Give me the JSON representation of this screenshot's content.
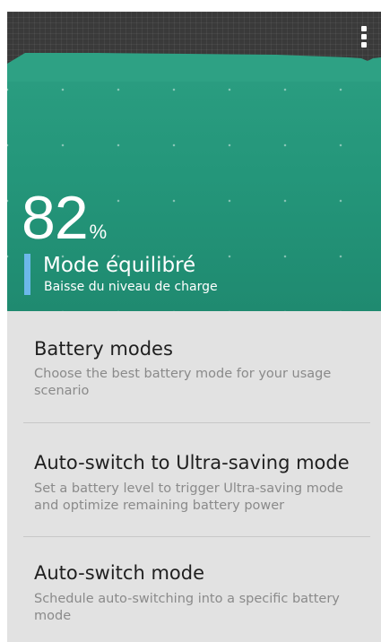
{
  "battery": {
    "percent": "82",
    "percent_sign": "%",
    "mode_title": "Mode équilibré",
    "mode_subtitle": "Baisse du niveau de charge"
  },
  "settings": {
    "items": [
      {
        "title": "Battery modes",
        "description": "Choose the best battery mode for your usage scenario"
      },
      {
        "title": "Auto-switch to Ultra-saving mode",
        "description": "Set a battery level to trigger Ultra-saving mode and optimize remaining battery power"
      },
      {
        "title": "Auto-switch mode",
        "description": "Schedule auto-switching into a specific battery mode"
      }
    ]
  },
  "colors": {
    "graph_green": "#2ea184",
    "mode_indicator_blue": "#6cb8ea",
    "list_background": "#e2e2e2",
    "title_text": "#1f1f1f",
    "description_text": "#8a8a8a"
  },
  "icons": {
    "overflow_menu": "more-vert-icon"
  }
}
